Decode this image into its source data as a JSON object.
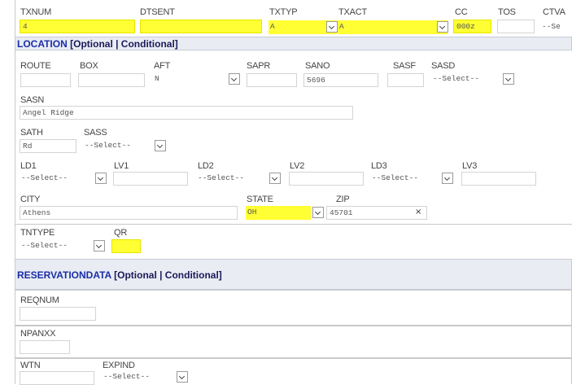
{
  "top_row": {
    "txnum": {
      "label": "TXNUM",
      "value": "4"
    },
    "dtsent": {
      "label": "DTSENT",
      "value": ""
    },
    "txtyp": {
      "label": "TXTYP",
      "value": "A"
    },
    "txact": {
      "label": "TXACT",
      "value": "A"
    },
    "cc": {
      "label": "CC",
      "value": "000z"
    },
    "tos": {
      "label": "TOS",
      "value": ""
    },
    "ctva": {
      "label": "CTVA",
      "value": "--Se"
    }
  },
  "location": {
    "title": "LOCATION",
    "subtitle": "[Optional | Conditional]",
    "route": {
      "label": "ROUTE",
      "value": ""
    },
    "box": {
      "label": "BOX",
      "value": ""
    },
    "aft": {
      "label": "AFT",
      "value": "N"
    },
    "sapr": {
      "label": "SAPR",
      "value": ""
    },
    "sano": {
      "label": "SANO",
      "value": "5696"
    },
    "sasf": {
      "label": "SASF",
      "value": ""
    },
    "sasd": {
      "label": "SASD",
      "value": "--Select--"
    },
    "sasn": {
      "label": "SASN",
      "value": "Angel Ridge"
    },
    "sath": {
      "label": "SATH",
      "value": "Rd"
    },
    "sass": {
      "label": "SASS",
      "value": "--Select--"
    },
    "ld1": {
      "label": "LD1",
      "value": "--Select--"
    },
    "lv1": {
      "label": "LV1",
      "value": ""
    },
    "ld2": {
      "label": "LD2",
      "value": "--Select--"
    },
    "lv2": {
      "label": "LV2",
      "value": ""
    },
    "ld3": {
      "label": "LD3",
      "value": "--Select--"
    },
    "lv3": {
      "label": "LV3",
      "value": ""
    },
    "city": {
      "label": "CITY",
      "value": "Athens"
    },
    "state": {
      "label": "STATE",
      "value": "OH"
    },
    "zip": {
      "label": "ZIP",
      "value": "45701",
      "clear": "×"
    },
    "tntype": {
      "label": "TNTYPE",
      "value": "--Select--"
    },
    "qr": {
      "label": "QR",
      "value": ""
    }
  },
  "reservation": {
    "title": "RESERVATIONDATA",
    "subtitle": "[Optional | Conditional]",
    "reqnum": {
      "label": "REQNUM",
      "value": ""
    },
    "npanxx": {
      "label": "NPANXX",
      "value": ""
    },
    "wtn": {
      "label": "WTN",
      "value": ""
    },
    "expind": {
      "label": "EXPIND",
      "value": "--Select--"
    }
  },
  "colors": {
    "highlight": "#ffff33",
    "section_title": "#1a2ea8",
    "section_bar": "#e9ecf3"
  }
}
